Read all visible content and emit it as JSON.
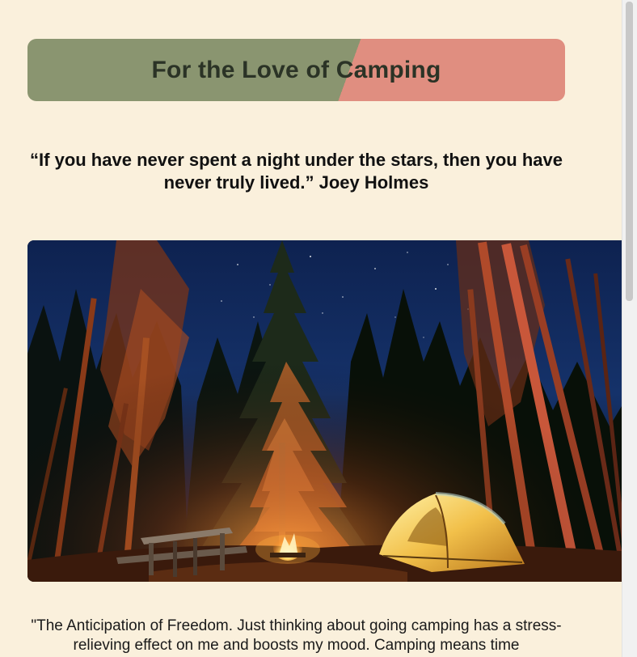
{
  "header": {
    "title": "For the Love of Camping"
  },
  "quote": {
    "text": "“If you have never spent a night under the stars, then you have never truly lived.” Joey Holmes"
  },
  "hero": {
    "subject": "campsite-at-night-with-tent-and-campfire"
  },
  "body": {
    "paragraph": "\"The Anticipation of Freedom. Just thinking about going camping has a stress-relieving effect on me and boosts my mood. Camping means time"
  },
  "colors": {
    "background": "#faf0dc",
    "banner_green": "#8a9570",
    "banner_salmon": "#e08e80",
    "title_text": "#2b3326"
  }
}
